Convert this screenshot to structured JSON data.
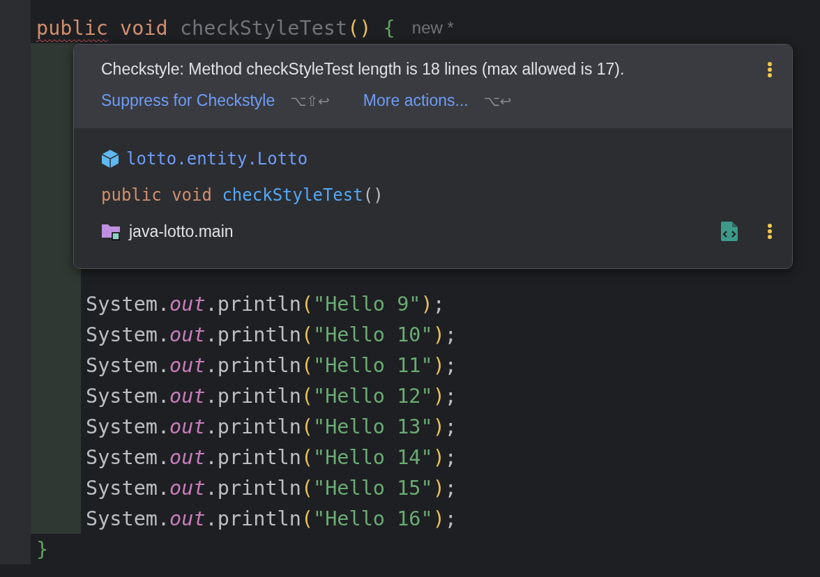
{
  "editor": {
    "lines": [
      {
        "kind": "declaration",
        "changed": false,
        "tokens": [
          {
            "kind": "keyword",
            "text": "public",
            "warning": true
          },
          {
            "kind": "keyword",
            "text": " void "
          },
          {
            "kind": "unused",
            "text": "checkStyleTest"
          },
          {
            "kind": "paren",
            "text": "()"
          },
          {
            "kind": "brace",
            "text": " {"
          }
        ],
        "hint": "new *"
      },
      {
        "kind": "statement",
        "changed": true,
        "tokens": [
          {
            "kind": "plain",
            "text": "System."
          },
          {
            "kind": "field",
            "text": "out"
          },
          {
            "kind": "plain",
            "text": ".println"
          },
          {
            "kind": "paren",
            "text": "("
          },
          {
            "kind": "string",
            "text": "\"Hello 9\""
          },
          {
            "kind": "paren",
            "text": ")"
          },
          {
            "kind": "plain",
            "text": ";"
          }
        ]
      },
      {
        "kind": "statement",
        "changed": true,
        "tokens": [
          {
            "kind": "plain",
            "text": "System."
          },
          {
            "kind": "field",
            "text": "out"
          },
          {
            "kind": "plain",
            "text": ".println"
          },
          {
            "kind": "paren",
            "text": "("
          },
          {
            "kind": "string",
            "text": "\"Hello 10\""
          },
          {
            "kind": "paren",
            "text": ")"
          },
          {
            "kind": "plain",
            "text": ";"
          }
        ]
      },
      {
        "kind": "statement",
        "changed": true,
        "tokens": [
          {
            "kind": "plain",
            "text": "System."
          },
          {
            "kind": "field",
            "text": "out"
          },
          {
            "kind": "plain",
            "text": ".println"
          },
          {
            "kind": "paren",
            "text": "("
          },
          {
            "kind": "string",
            "text": "\"Hello 11\""
          },
          {
            "kind": "paren",
            "text": ")"
          },
          {
            "kind": "plain",
            "text": ";"
          }
        ]
      },
      {
        "kind": "statement",
        "changed": true,
        "tokens": [
          {
            "kind": "plain",
            "text": "System."
          },
          {
            "kind": "field",
            "text": "out"
          },
          {
            "kind": "plain",
            "text": ".println"
          },
          {
            "kind": "paren",
            "text": "("
          },
          {
            "kind": "string",
            "text": "\"Hello 12\""
          },
          {
            "kind": "paren",
            "text": ")"
          },
          {
            "kind": "plain",
            "text": ";"
          }
        ]
      },
      {
        "kind": "statement",
        "changed": true,
        "tokens": [
          {
            "kind": "plain",
            "text": "System."
          },
          {
            "kind": "field",
            "text": "out"
          },
          {
            "kind": "plain",
            "text": ".println"
          },
          {
            "kind": "paren",
            "text": "("
          },
          {
            "kind": "string",
            "text": "\"Hello 13\""
          },
          {
            "kind": "paren",
            "text": ")"
          },
          {
            "kind": "plain",
            "text": ";"
          }
        ]
      },
      {
        "kind": "statement",
        "changed": true,
        "tokens": [
          {
            "kind": "plain",
            "text": "System."
          },
          {
            "kind": "field",
            "text": "out"
          },
          {
            "kind": "plain",
            "text": ".println"
          },
          {
            "kind": "paren",
            "text": "("
          },
          {
            "kind": "string",
            "text": "\"Hello 14\""
          },
          {
            "kind": "paren",
            "text": ")"
          },
          {
            "kind": "plain",
            "text": ";"
          }
        ]
      },
      {
        "kind": "statement",
        "changed": true,
        "tokens": [
          {
            "kind": "plain",
            "text": "System."
          },
          {
            "kind": "field",
            "text": "out"
          },
          {
            "kind": "plain",
            "text": ".println"
          },
          {
            "kind": "paren",
            "text": "("
          },
          {
            "kind": "string",
            "text": "\"Hello 15\""
          },
          {
            "kind": "paren",
            "text": ")"
          },
          {
            "kind": "plain",
            "text": ";"
          }
        ]
      },
      {
        "kind": "statement",
        "changed": true,
        "tokens": [
          {
            "kind": "plain",
            "text": "System."
          },
          {
            "kind": "field",
            "text": "out"
          },
          {
            "kind": "plain",
            "text": ".println"
          },
          {
            "kind": "paren",
            "text": "("
          },
          {
            "kind": "string",
            "text": "\"Hello 16\""
          },
          {
            "kind": "paren",
            "text": ")"
          },
          {
            "kind": "plain",
            "text": ";"
          }
        ]
      },
      {
        "kind": "closing",
        "changed": false,
        "tokens": [
          {
            "kind": "brace",
            "text": "}"
          }
        ]
      }
    ]
  },
  "popup": {
    "message": "Checkstyle: Method checkStyleTest length is 18 lines (max allowed is 17).",
    "actions": [
      {
        "label": "Suppress for Checkstyle",
        "shortcut": "⌥⇧↩"
      },
      {
        "label": "More actions...",
        "shortcut": "⌥↩"
      }
    ],
    "class_name": "lotto.entity.Lotto",
    "signature": [
      {
        "kind": "keyword",
        "text": "public void "
      },
      {
        "kind": "method",
        "text": "checkStyleTest"
      },
      {
        "kind": "plain",
        "text": "()"
      }
    ],
    "module": "java-lotto.main"
  }
}
